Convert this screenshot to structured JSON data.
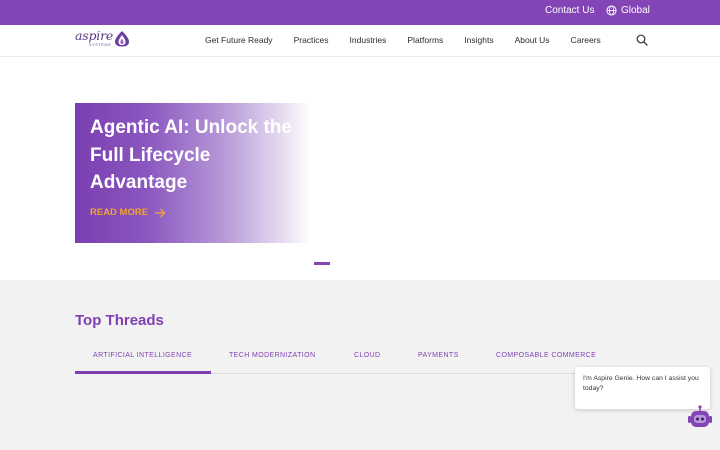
{
  "topbar": {
    "contact_label": "Contact Us",
    "global_label": "Global",
    "globe_icon": "globe-icon"
  },
  "logo": {
    "word": "aspire",
    "sub": "SYSTEMS"
  },
  "nav": {
    "items": [
      {
        "label": "Get Future Ready"
      },
      {
        "label": "Practices"
      },
      {
        "label": "Industries"
      },
      {
        "label": "Platforms"
      },
      {
        "label": "Insights"
      },
      {
        "label": "About Us"
      },
      {
        "label": "Careers"
      }
    ],
    "search_icon": "search-icon"
  },
  "hero": {
    "title": "Agentic AI: Unlock the\nFull Lifecycle\nAdvantage",
    "read_more": "READ MORE",
    "arrow_icon": "arrow-right-icon"
  },
  "threads": {
    "title": "Top Threads",
    "tabs": [
      {
        "label": "ARTIFICIAL INTELLIGENCE",
        "active": true
      },
      {
        "label": "TECH MODERNIZATION",
        "active": false
      },
      {
        "label": "CLOUD",
        "active": false
      },
      {
        "label": "PAYMENTS",
        "active": false
      },
      {
        "label": "COMPOSABLE COMMERCE",
        "active": false
      }
    ]
  },
  "chat": {
    "message": "I'm Aspire Genie. How can I assist you today?",
    "bot_icon": "robot-icon"
  },
  "colors": {
    "brand_purple": "#8344b6",
    "accent_orange": "#f0a23a",
    "section_gray": "#f2f2f2"
  }
}
